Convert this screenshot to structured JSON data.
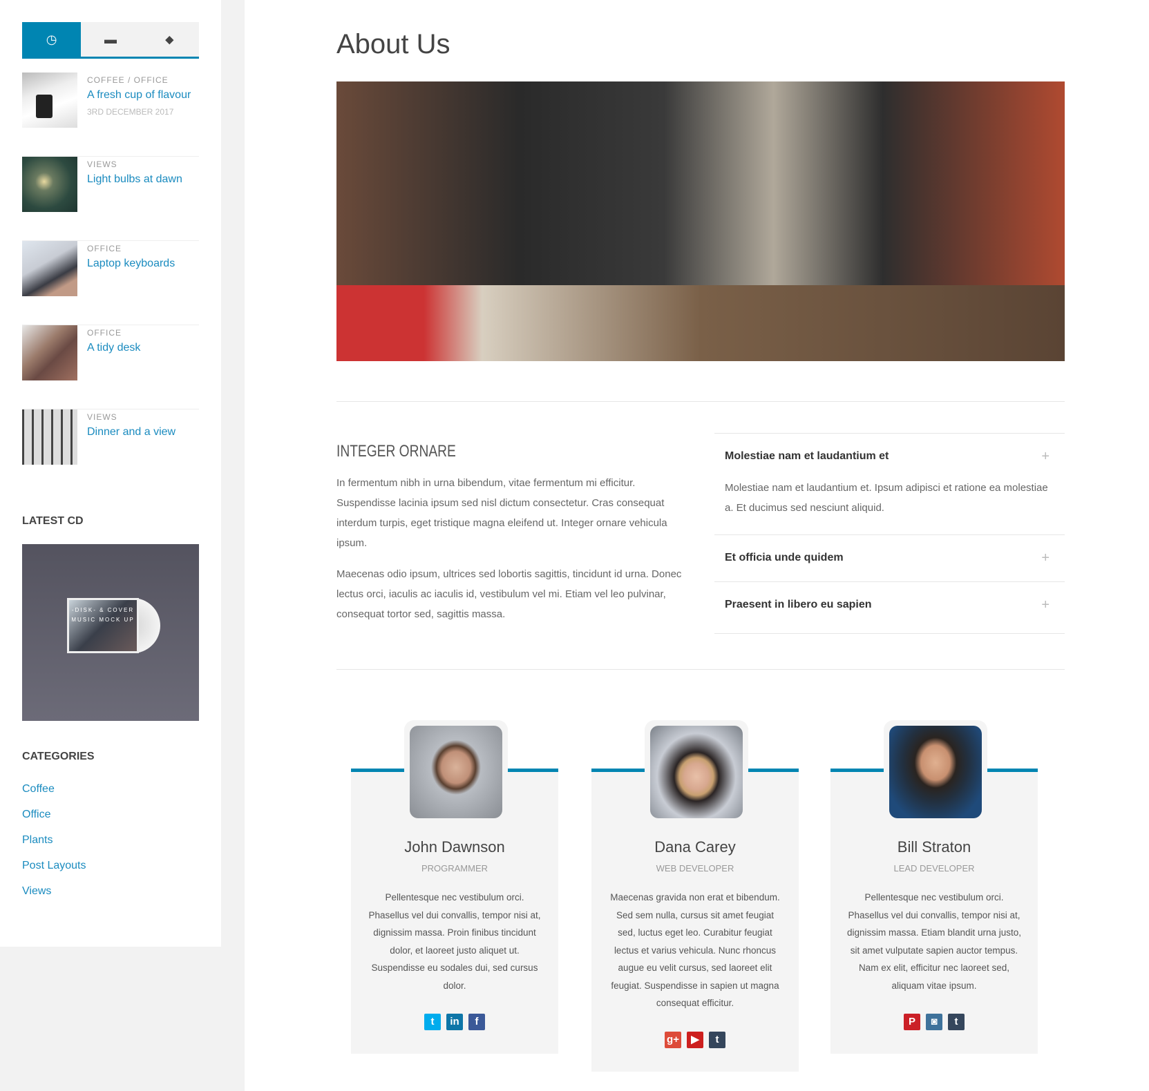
{
  "sidebar": {
    "tabs": [
      {
        "icon": "clock-icon",
        "glyph": "◷"
      },
      {
        "icon": "comment-icon",
        "glyph": "▬"
      },
      {
        "icon": "tags-icon",
        "glyph": "⬥"
      }
    ],
    "posts": [
      {
        "category": "COFFEE / OFFICE",
        "title": "A fresh cup of flavour",
        "date": "3RD DECEMBER 2017"
      },
      {
        "category": "VIEWS",
        "title": "Light bulbs at dawn"
      },
      {
        "category": "OFFICE",
        "title": "Laptop keyboards"
      },
      {
        "category": "OFFICE",
        "title": "A tidy desk"
      },
      {
        "category": "VIEWS",
        "title": "Dinner and a view"
      }
    ],
    "latest_cd_title": "LATEST CD",
    "cd_cover_text": "-DISK- & COVER MUSIC MOCK UP",
    "categories_title": "CATEGORIES",
    "categories": [
      "Coffee",
      "Office",
      "Plants",
      "Post Layouts",
      "Views"
    ]
  },
  "main": {
    "title": "About Us",
    "section_title": "INTEGER ORNARE",
    "paragraphs": [
      "In fermentum nibh in urna bibendum, vitae fermentum mi efficitur. Suspendisse lacinia ipsum sed nisl dictum consectetur. Cras consequat interdum turpis, eget tristique magna eleifend ut. Integer ornare vehicula ipsum.",
      "Maecenas odio ipsum, ultrices sed lobortis sagittis, tincidunt id urna. Donec lectus orci, iaculis ac iaculis id, vestibulum vel mi. Etiam vel leo pulvinar, consequat tortor sed, sagittis massa."
    ],
    "accordion": [
      {
        "title": "Molestiae nam et laudantium et",
        "body": "Molestiae nam et laudantium et. Ipsum adipisci et ratione ea molestiae a. Et ducimus sed nesciunt aliquid.",
        "expanded": true
      },
      {
        "title": "Et officia unde quidem",
        "expanded": false
      },
      {
        "title": "Praesent in libero eu sapien",
        "expanded": false
      }
    ],
    "plus": "+",
    "team": [
      {
        "name": "John Dawnson",
        "role": "PROGRAMMER",
        "bio": "Pellentesque nec vestibulum orci. Phasellus vel dui convallis, tempor nisi at, dignissim massa. Proin finibus tincidunt dolor, et laoreet justo aliquet ut. Suspendisse eu sodales dui, sed cursus dolor.",
        "socials": [
          {
            "icon": "twitter-icon",
            "glyph": "t",
            "color": "#00aced"
          },
          {
            "icon": "linkedin-icon",
            "glyph": "in",
            "color": "#0e76a8"
          },
          {
            "icon": "facebook-icon",
            "glyph": "f",
            "color": "#3b5998"
          }
        ]
      },
      {
        "name": "Dana Carey",
        "role": "WEB DEVELOPER",
        "bio": "Maecenas gravida non erat et bibendum. Sed sem nulla, cursus sit amet feugiat sed, luctus eget leo. Curabitur feugiat lectus et varius vehicula. Nunc rhoncus augue eu velit cursus, sed laoreet elit feugiat. Suspendisse in sapien ut magna consequat efficitur.",
        "socials": [
          {
            "icon": "google-plus-icon",
            "glyph": "g+",
            "color": "#dd4b39"
          },
          {
            "icon": "youtube-icon",
            "glyph": "▶",
            "color": "#cd201f"
          },
          {
            "icon": "tumblr-icon",
            "glyph": "t",
            "color": "#35465c"
          }
        ]
      },
      {
        "name": "Bill Straton",
        "role": "LEAD DEVELOPER",
        "bio": "Pellentesque nec vestibulum orci. Phasellus vel dui convallis, tempor nisi at, dignissim massa. Etiam blandit urna justo, sit amet vulputate sapien auctor tempus. Nam ex elit, efficitur nec laoreet sed, aliquam vitae ipsum.",
        "socials": [
          {
            "icon": "pinterest-icon",
            "glyph": "P",
            "color": "#cb2027"
          },
          {
            "icon": "instagram-icon",
            "glyph": "◙",
            "color": "#3f729b"
          },
          {
            "icon": "tumblr-icon",
            "glyph": "t",
            "color": "#35465c"
          }
        ]
      }
    ]
  },
  "colors": {
    "accent": "#0085b2",
    "link": "#1a8bbf"
  }
}
